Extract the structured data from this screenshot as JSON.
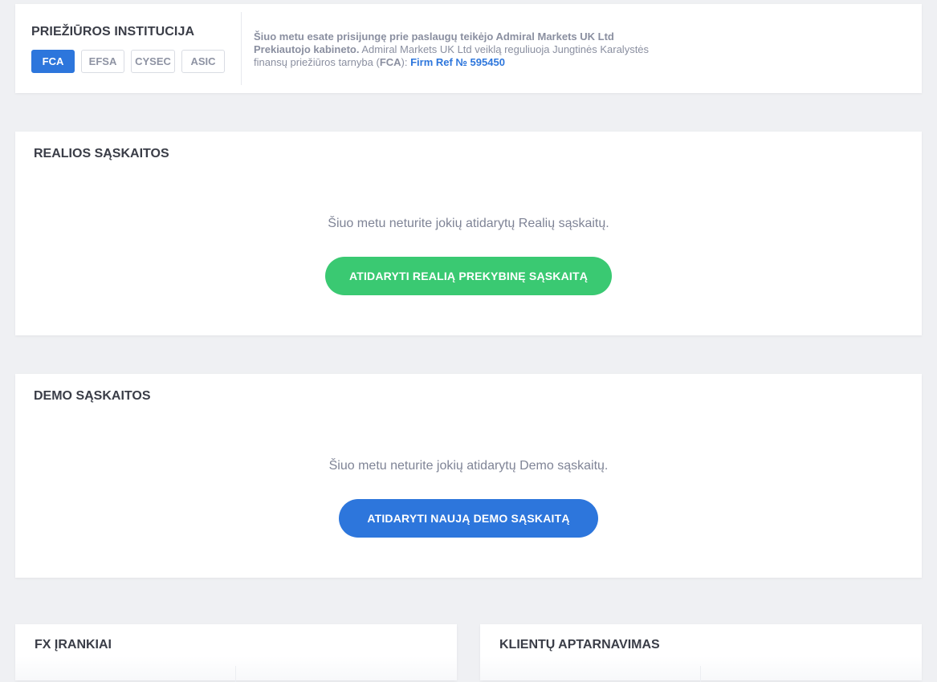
{
  "regulator": {
    "title": "PRIEŽIŪROS INSTITUCIJA",
    "tabs": [
      {
        "label": "FCA",
        "active": true
      },
      {
        "label": "EFSA",
        "active": false
      },
      {
        "label": "CYSEC",
        "active": false
      },
      {
        "label": "ASIC",
        "active": false
      }
    ],
    "text_bold": "Šiuo metu esate prisijungę prie paslaugų teikėjo Admiral Markets UK Ltd Prekiautojo kabineto.",
    "text_normal": " Admiral Markets UK Ltd veiklą reguliuoja Jungtinės Karalystės finansų priežiūros tarnyba (",
    "text_fca": "FCA",
    "text_after": "): ",
    "firm_ref_link": "Firm Ref № 595450"
  },
  "real_accounts": {
    "title": "REALIOS SĄSKAITOS",
    "message": "Šiuo metu neturite jokių atidarytų Realių sąskaitų.",
    "button_label": "ATIDARYTI REALIĄ PREKYBINĘ SĄSKAITĄ"
  },
  "demo_accounts": {
    "title": "DEMO SĄSKAITOS",
    "message": "Šiuo metu neturite jokių atidarytų Demo sąskaitų.",
    "button_label": "ATIDARYTI NAUJĄ DEMO SĄSKAITĄ"
  },
  "fx_tools": {
    "title": "FX ĮRANKIAI"
  },
  "client_service": {
    "title": "KLIENTŲ APTARNAVIMAS"
  },
  "colors": {
    "accent_blue": "#2d76dc",
    "accent_green": "#3ac972",
    "background": "#eff0f3"
  }
}
